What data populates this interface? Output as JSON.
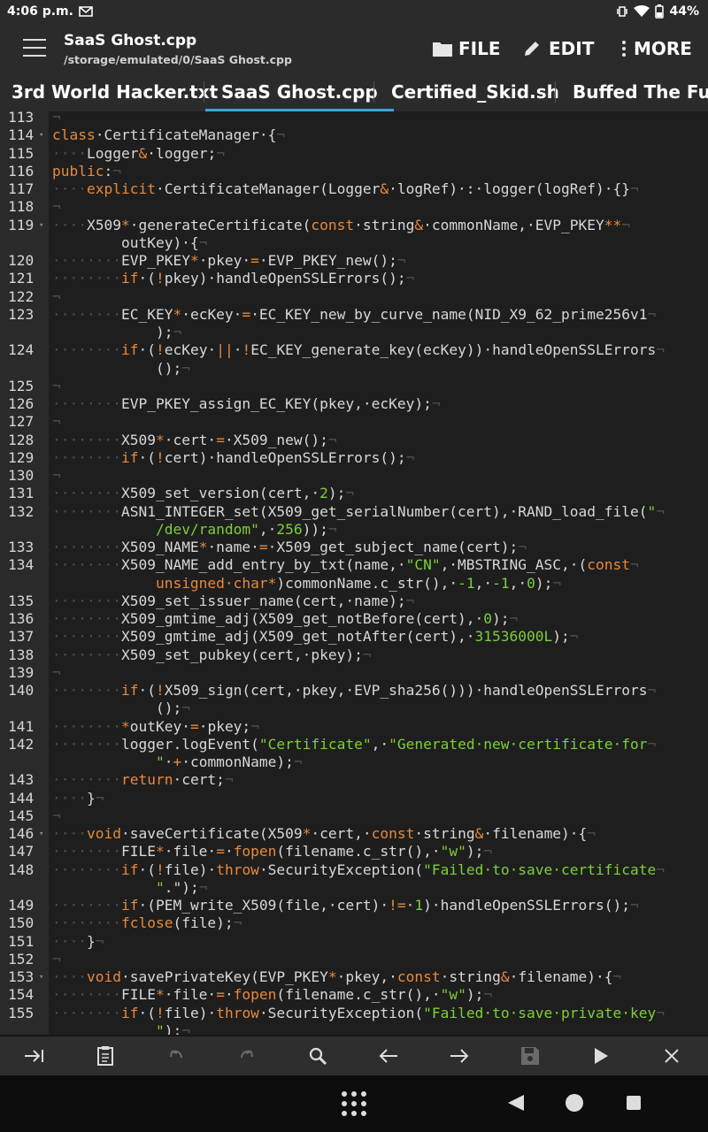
{
  "status": {
    "time": "4:06 p.m.",
    "battery": "44%"
  },
  "appbar": {
    "title": "SaaS Ghost.cpp",
    "path": "/storage/emulated/0/SaaS Ghost.cpp",
    "file_label": "FILE",
    "edit_label": "EDIT",
    "more_label": "MORE"
  },
  "tabs": [
    {
      "label": "3rd World Hacker.txt"
    },
    {
      "label": "SaaS Ghost.cpp"
    },
    {
      "label": "Certified_Skid.sh"
    },
    {
      "label": "Buffed The Fuck"
    }
  ],
  "colors": {
    "keyword": "#e8893a",
    "string": "#7ccf3a",
    "accent": "#3ea3dc",
    "code_text": "#d8d8d8"
  },
  "lines": [
    {
      "n": "113",
      "fold": false,
      "parts": []
    },
    {
      "n": "114",
      "fold": true,
      "parts": [
        [
          "kw",
          "class"
        ],
        [
          "",
          "·CertificateManager·{"
        ]
      ]
    },
    {
      "n": "115",
      "fold": false,
      "parts": [
        [
          "ws",
          "····"
        ],
        [
          "",
          "Logger"
        ],
        [
          "kw",
          "&"
        ],
        [
          "",
          "·logger;"
        ]
      ]
    },
    {
      "n": "116",
      "fold": false,
      "parts": [
        [
          "kw",
          "public"
        ],
        [
          "",
          ":"
        ]
      ]
    },
    {
      "n": "117",
      "fold": false,
      "parts": [
        [
          "ws",
          "····"
        ],
        [
          "kw",
          "explicit"
        ],
        [
          "",
          "·CertificateManager(Logger"
        ],
        [
          "kw",
          "&"
        ],
        [
          "",
          "·logRef)·:·logger(logRef)·{}"
        ]
      ]
    },
    {
      "n": "118",
      "fold": false,
      "parts": []
    },
    {
      "n": "119",
      "fold": true,
      "parts": [
        [
          "ws",
          "····"
        ],
        [
          "",
          "X509"
        ],
        [
          "kw",
          "*"
        ],
        [
          "",
          "·generateCertificate("
        ],
        [
          "kw",
          "const"
        ],
        [
          "",
          "·string"
        ],
        [
          "kw",
          "&"
        ],
        [
          "",
          "·commonName,·EVP_PKEY"
        ],
        [
          "kw",
          "**"
        ]
      ]
    },
    {
      "n": "",
      "fold": false,
      "parts": [
        [
          "",
          "        outKey)·{"
        ]
      ]
    },
    {
      "n": "120",
      "fold": false,
      "parts": [
        [
          "ws",
          "········"
        ],
        [
          "",
          "EVP_PKEY"
        ],
        [
          "kw",
          "*"
        ],
        [
          "",
          "·pkey·"
        ],
        [
          "kw",
          "="
        ],
        [
          "",
          "·EVP_PKEY_new();"
        ]
      ]
    },
    {
      "n": "121",
      "fold": false,
      "parts": [
        [
          "ws",
          "········"
        ],
        [
          "kw",
          "if"
        ],
        [
          "",
          "·("
        ],
        [
          "kw",
          "!"
        ],
        [
          "",
          "pkey)·handleOpenSSLErrors();"
        ]
      ]
    },
    {
      "n": "122",
      "fold": false,
      "parts": []
    },
    {
      "n": "123",
      "fold": false,
      "parts": [
        [
          "ws",
          "········"
        ],
        [
          "",
          "EC_KEY"
        ],
        [
          "kw",
          "*"
        ],
        [
          "",
          "·ecKey·"
        ],
        [
          "kw",
          "="
        ],
        [
          "",
          "·EC_KEY_new_by_curve_name(NID_X9_62_prime256v1"
        ]
      ]
    },
    {
      "n": "",
      "fold": false,
      "parts": [
        [
          "",
          "            );"
        ]
      ]
    },
    {
      "n": "124",
      "fold": false,
      "parts": [
        [
          "ws",
          "········"
        ],
        [
          "kw",
          "if"
        ],
        [
          "",
          "·("
        ],
        [
          "kw",
          "!"
        ],
        [
          "",
          "ecKey·"
        ],
        [
          "kw",
          "||"
        ],
        [
          "",
          "·"
        ],
        [
          "kw",
          "!"
        ],
        [
          "",
          "EC_KEY_generate_key(ecKey))·handleOpenSSLErrors"
        ]
      ]
    },
    {
      "n": "",
      "fold": false,
      "parts": [
        [
          "",
          "            ();"
        ]
      ]
    },
    {
      "n": "125",
      "fold": false,
      "parts": []
    },
    {
      "n": "126",
      "fold": false,
      "parts": [
        [
          "ws",
          "········"
        ],
        [
          "",
          "EVP_PKEY_assign_EC_KEY(pkey,·ecKey);"
        ]
      ]
    },
    {
      "n": "127",
      "fold": false,
      "parts": []
    },
    {
      "n": "128",
      "fold": false,
      "parts": [
        [
          "ws",
          "········"
        ],
        [
          "",
          "X509"
        ],
        [
          "kw",
          "*"
        ],
        [
          "",
          "·cert·"
        ],
        [
          "kw",
          "="
        ],
        [
          "",
          "·X509_new();"
        ]
      ]
    },
    {
      "n": "129",
      "fold": false,
      "parts": [
        [
          "ws",
          "········"
        ],
        [
          "kw",
          "if"
        ],
        [
          "",
          "·("
        ],
        [
          "kw",
          "!"
        ],
        [
          "",
          "cert)·handleOpenSSLErrors();"
        ]
      ]
    },
    {
      "n": "130",
      "fold": false,
      "parts": []
    },
    {
      "n": "131",
      "fold": false,
      "parts": [
        [
          "ws",
          "········"
        ],
        [
          "",
          "X509_set_version(cert,·"
        ],
        [
          "num",
          "2"
        ],
        [
          "",
          ");"
        ]
      ]
    },
    {
      "n": "132",
      "fold": false,
      "parts": [
        [
          "ws",
          "········"
        ],
        [
          "",
          "ASN1_INTEGER_set(X509_get_serialNumber(cert),·RAND_load_file("
        ],
        [
          "str",
          "\""
        ]
      ]
    },
    {
      "n": "",
      "fold": false,
      "parts": [
        [
          "",
          "            "
        ],
        [
          "str",
          "/dev/random\""
        ],
        [
          "",
          ",·"
        ],
        [
          "num",
          "256"
        ],
        [
          "",
          "));"
        ]
      ]
    },
    {
      "n": "133",
      "fold": false,
      "parts": [
        [
          "ws",
          "········"
        ],
        [
          "",
          "X509_NAME"
        ],
        [
          "kw",
          "*"
        ],
        [
          "",
          "·name·"
        ],
        [
          "kw",
          "="
        ],
        [
          "",
          "·X509_get_subject_name(cert);"
        ]
      ]
    },
    {
      "n": "134",
      "fold": false,
      "parts": [
        [
          "ws",
          "········"
        ],
        [
          "",
          "X509_NAME_add_entry_by_txt(name,·"
        ],
        [
          "str",
          "\"CN\""
        ],
        [
          "",
          ",·MBSTRING_ASC,·("
        ],
        [
          "kw",
          "const"
        ]
      ]
    },
    {
      "n": "",
      "fold": false,
      "parts": [
        [
          "",
          "            "
        ],
        [
          "kw",
          "unsigned·char*"
        ],
        [
          "",
          ")commonName.c_str(),·"
        ],
        [
          "num",
          "-1"
        ],
        [
          "",
          ",·"
        ],
        [
          "num",
          "-1"
        ],
        [
          "",
          ",·"
        ],
        [
          "num",
          "0"
        ],
        [
          "",
          ");"
        ]
      ]
    },
    {
      "n": "135",
      "fold": false,
      "parts": [
        [
          "ws",
          "········"
        ],
        [
          "",
          "X509_set_issuer_name(cert,·name);"
        ]
      ]
    },
    {
      "n": "136",
      "fold": false,
      "parts": [
        [
          "ws",
          "········"
        ],
        [
          "",
          "X509_gmtime_adj(X509_get_notBefore(cert),·"
        ],
        [
          "num",
          "0"
        ],
        [
          "",
          ");"
        ]
      ]
    },
    {
      "n": "137",
      "fold": false,
      "parts": [
        [
          "ws",
          "········"
        ],
        [
          "",
          "X509_gmtime_adj(X509_get_notAfter(cert),·"
        ],
        [
          "num",
          "31536000L"
        ],
        [
          "",
          ");"
        ]
      ]
    },
    {
      "n": "138",
      "fold": false,
      "parts": [
        [
          "ws",
          "········"
        ],
        [
          "",
          "X509_set_pubkey(cert,·pkey);"
        ]
      ]
    },
    {
      "n": "139",
      "fold": false,
      "parts": []
    },
    {
      "n": "140",
      "fold": false,
      "parts": [
        [
          "ws",
          "········"
        ],
        [
          "kw",
          "if"
        ],
        [
          "",
          "·("
        ],
        [
          "kw",
          "!"
        ],
        [
          "",
          "X509_sign(cert,·pkey,·EVP_sha256()))·handleOpenSSLErrors"
        ]
      ]
    },
    {
      "n": "",
      "fold": false,
      "parts": [
        [
          "",
          "            ();"
        ]
      ]
    },
    {
      "n": "141",
      "fold": false,
      "parts": [
        [
          "ws",
          "········"
        ],
        [
          "kw",
          "*"
        ],
        [
          "",
          "outKey·"
        ],
        [
          "kw",
          "="
        ],
        [
          "",
          "·pkey;"
        ]
      ]
    },
    {
      "n": "142",
      "fold": false,
      "parts": [
        [
          "ws",
          "········"
        ],
        [
          "",
          "logger.logEvent("
        ],
        [
          "str",
          "\"Certificate\""
        ],
        [
          "",
          ",·"
        ],
        [
          "str",
          "\"Generated·new·certificate·for"
        ]
      ]
    },
    {
      "n": "",
      "fold": false,
      "parts": [
        [
          "",
          "            "
        ],
        [
          "str",
          "\""
        ],
        [
          "",
          "·"
        ],
        [
          "kw",
          "+"
        ],
        [
          "",
          "·commonName);"
        ]
      ]
    },
    {
      "n": "143",
      "fold": false,
      "parts": [
        [
          "ws",
          "········"
        ],
        [
          "kw",
          "return"
        ],
        [
          "",
          "·cert;"
        ]
      ]
    },
    {
      "n": "144",
      "fold": false,
      "parts": [
        [
          "ws",
          "····"
        ],
        [
          "",
          "}"
        ]
      ]
    },
    {
      "n": "145",
      "fold": false,
      "parts": []
    },
    {
      "n": "146",
      "fold": true,
      "parts": [
        [
          "ws",
          "····"
        ],
        [
          "kw",
          "void"
        ],
        [
          "",
          "·saveCertificate(X509"
        ],
        [
          "kw",
          "*"
        ],
        [
          "",
          "·cert,·"
        ],
        [
          "kw",
          "const"
        ],
        [
          "",
          "·string"
        ],
        [
          "kw",
          "&"
        ],
        [
          "",
          "·filename)·{"
        ]
      ]
    },
    {
      "n": "147",
      "fold": false,
      "parts": [
        [
          "ws",
          "········"
        ],
        [
          "",
          "FILE"
        ],
        [
          "kw",
          "*"
        ],
        [
          "",
          "·file·"
        ],
        [
          "kw",
          "="
        ],
        [
          "",
          "·"
        ],
        [
          "kw",
          "fopen"
        ],
        [
          "",
          "(filename.c_str(),·"
        ],
        [
          "str",
          "\"w\""
        ],
        [
          "",
          ");"
        ]
      ]
    },
    {
      "n": "148",
      "fold": false,
      "parts": [
        [
          "ws",
          "········"
        ],
        [
          "kw",
          "if"
        ],
        [
          "",
          "·("
        ],
        [
          "kw",
          "!"
        ],
        [
          "",
          "file)·"
        ],
        [
          "kw",
          "throw"
        ],
        [
          "",
          "·SecurityException("
        ],
        [
          "str",
          "\"Failed·to·save·certificate"
        ]
      ]
    },
    {
      "n": "",
      "fold": false,
      "parts": [
        [
          "",
          "            "
        ],
        [
          "str",
          "\""
        ],
        [
          "",
          ".\");"
        ]
      ]
    },
    {
      "n": "149",
      "fold": false,
      "parts": [
        [
          "ws",
          "········"
        ],
        [
          "kw",
          "if"
        ],
        [
          "",
          "·(PEM_write_X509(file,·cert)·"
        ],
        [
          "kw",
          "!="
        ],
        [
          "",
          "·"
        ],
        [
          "num",
          "1"
        ],
        [
          "",
          ")·handleOpenSSLErrors();"
        ]
      ]
    },
    {
      "n": "150",
      "fold": false,
      "parts": [
        [
          "ws",
          "········"
        ],
        [
          "kw",
          "fclose"
        ],
        [
          "",
          "(file);"
        ]
      ]
    },
    {
      "n": "151",
      "fold": false,
      "parts": [
        [
          "ws",
          "····"
        ],
        [
          "",
          "}"
        ]
      ]
    },
    {
      "n": "152",
      "fold": false,
      "parts": []
    },
    {
      "n": "153",
      "fold": true,
      "parts": [
        [
          "ws",
          "····"
        ],
        [
          "kw",
          "void"
        ],
        [
          "",
          "·savePrivateKey(EVP_PKEY"
        ],
        [
          "kw",
          "*"
        ],
        [
          "",
          "·pkey,·"
        ],
        [
          "kw",
          "const"
        ],
        [
          "",
          "·string"
        ],
        [
          "kw",
          "&"
        ],
        [
          "",
          "·filename)·{"
        ]
      ]
    },
    {
      "n": "154",
      "fold": false,
      "parts": [
        [
          "ws",
          "········"
        ],
        [
          "",
          "FILE"
        ],
        [
          "kw",
          "*"
        ],
        [
          "",
          "·file·"
        ],
        [
          "kw",
          "="
        ],
        [
          "",
          "·"
        ],
        [
          "kw",
          "fopen"
        ],
        [
          "",
          "(filename.c_str(),·"
        ],
        [
          "str",
          "\"w\""
        ],
        [
          "",
          ");"
        ]
      ]
    },
    {
      "n": "155",
      "fold": false,
      "parts": [
        [
          "ws",
          "········"
        ],
        [
          "kw",
          "if"
        ],
        [
          "",
          "·("
        ],
        [
          "kw",
          "!"
        ],
        [
          "",
          "file)·"
        ],
        [
          "kw",
          "throw"
        ],
        [
          "",
          "·SecurityException("
        ],
        [
          "str",
          "\"Failed·to·save·private·key"
        ]
      ]
    },
    {
      "n": "",
      "fold": false,
      "parts": [
        [
          "",
          "            "
        ],
        [
          "str",
          "\""
        ],
        [
          "",
          ");"
        ]
      ]
    }
  ],
  "toolbar_icons": [
    "tab-indent-icon",
    "paste-icon",
    "undo-icon",
    "redo-icon",
    "search-icon",
    "arrow-left-icon",
    "arrow-right-icon",
    "save-icon",
    "run-icon",
    "close-icon"
  ],
  "nav_icons": [
    "app-drawer-icon",
    "back-icon",
    "home-icon",
    "recents-icon"
  ]
}
